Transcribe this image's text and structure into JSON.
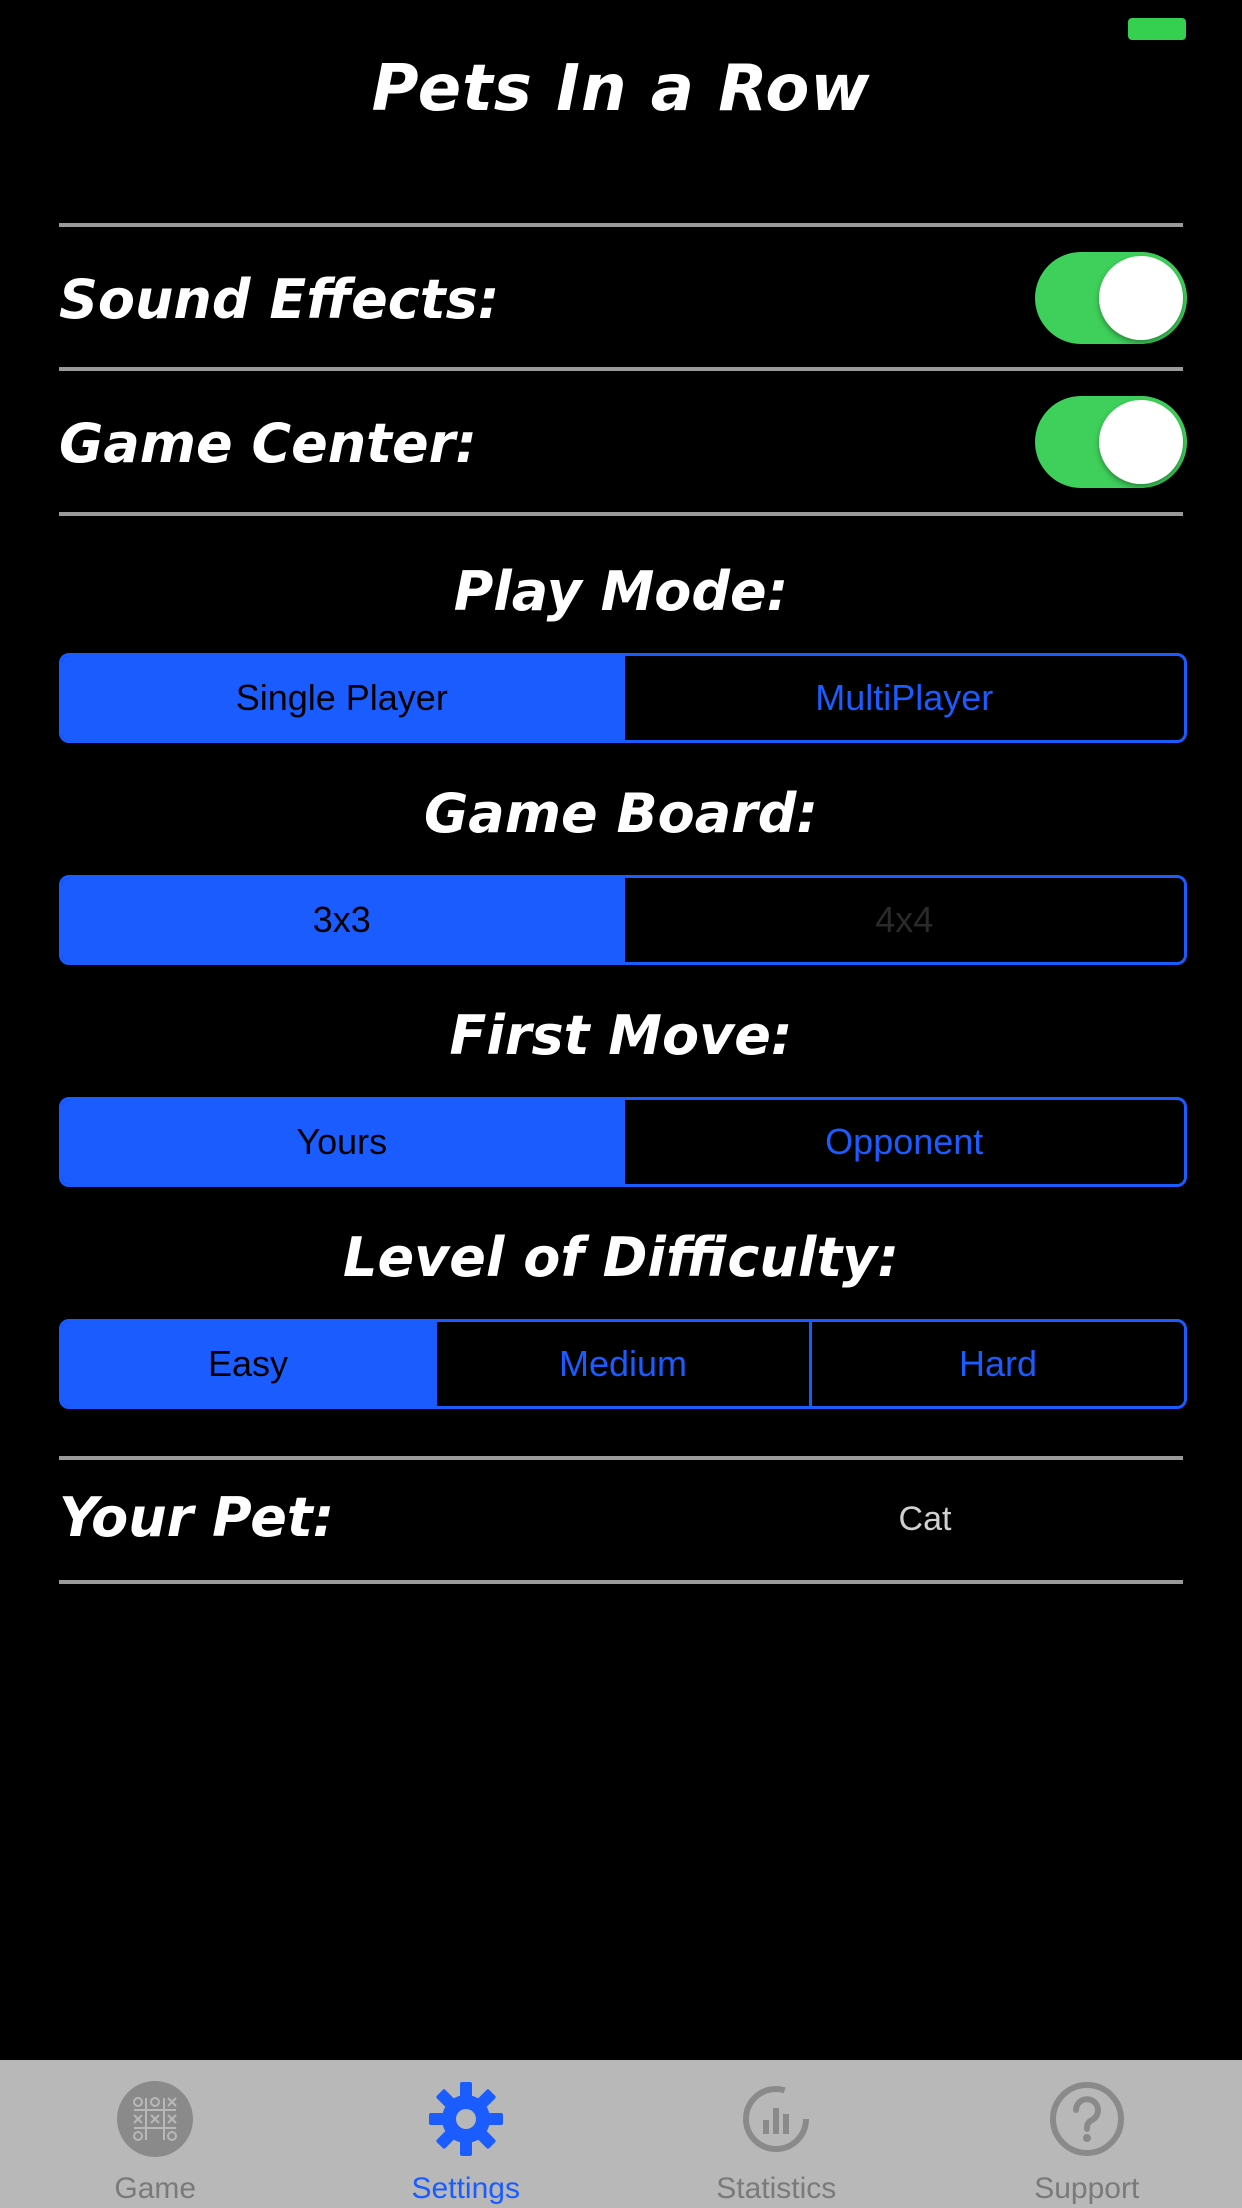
{
  "app": {
    "title": "Pets In a Row"
  },
  "settings": {
    "sound_effects": {
      "label": "Sound Effects:",
      "on": true
    },
    "game_center": {
      "label": "Game Center:",
      "on": true
    }
  },
  "play_mode": {
    "title": "Play Mode:",
    "options": [
      "Single Player",
      "MultiPlayer"
    ],
    "selected": "Single Player"
  },
  "game_board": {
    "title": "Game Board:",
    "options": [
      "3x3",
      "4x4"
    ],
    "selected": "3x3",
    "disabled": [
      "4x4"
    ]
  },
  "first_move": {
    "title": "First Move:",
    "options": [
      "Yours",
      "Opponent"
    ],
    "selected": "Yours"
  },
  "difficulty": {
    "title": "Level of Difficulty:",
    "options": [
      "Easy",
      "Medium",
      "Hard"
    ],
    "selected": "Easy"
  },
  "pet": {
    "label": "Your Pet:",
    "value": "Cat"
  },
  "tabbar": {
    "tabs": [
      {
        "label": "Game",
        "icon": "tic-tac-toe-icon",
        "active": false
      },
      {
        "label": "Settings",
        "icon": "gear-icon",
        "active": true
      },
      {
        "label": "Statistics",
        "icon": "statistics-icon",
        "active": false
      },
      {
        "label": "Support",
        "icon": "question-icon",
        "active": false
      }
    ]
  },
  "colors": {
    "accent": "#1a5cff",
    "toggle_on": "#3ed05a",
    "background": "#000000",
    "tabbar": "#b8b8b8"
  }
}
